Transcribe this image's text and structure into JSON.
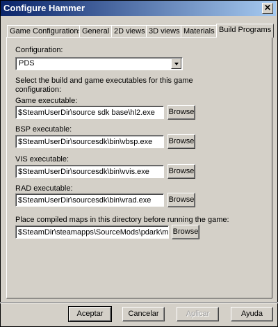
{
  "window": {
    "title": "Configure Hammer",
    "close_glyph": "✕"
  },
  "tabs": [
    {
      "label": "Game Configurations"
    },
    {
      "label": "General"
    },
    {
      "label": "2D views"
    },
    {
      "label": "3D views"
    },
    {
      "label": "Materials"
    },
    {
      "label": "Build Programs"
    }
  ],
  "config": {
    "label": "Configuration:",
    "value": "PDS"
  },
  "description": "Select the build and game executables for this game configuration:",
  "fields": [
    {
      "label": "Game executable:",
      "value": "$SteamUserDir\\source sdk base\\hl2.exe",
      "browse": "Browse"
    },
    {
      "label": "BSP executable:",
      "value": "$SteamUserDir\\sourcesdk\\bin\\vbsp.exe",
      "browse": "Browse"
    },
    {
      "label": "VIS executable:",
      "value": "$SteamUserDir\\sourcesdk\\bin\\vvis.exe",
      "browse": "Browse"
    },
    {
      "label": "RAD executable:",
      "value": "$SteamUserDir\\sourcesdk\\bin\\vrad.exe",
      "browse": "Browse"
    }
  ],
  "maps": {
    "label": "Place compiled maps in this directory before running the game:",
    "value": "$SteamDir\\steamapps\\SourceMods\\pdark\\maps",
    "browse": "Browse"
  },
  "footer": {
    "ok": "Aceptar",
    "cancel": "Cancelar",
    "apply": "Aplicar",
    "help": "Ayuda"
  }
}
